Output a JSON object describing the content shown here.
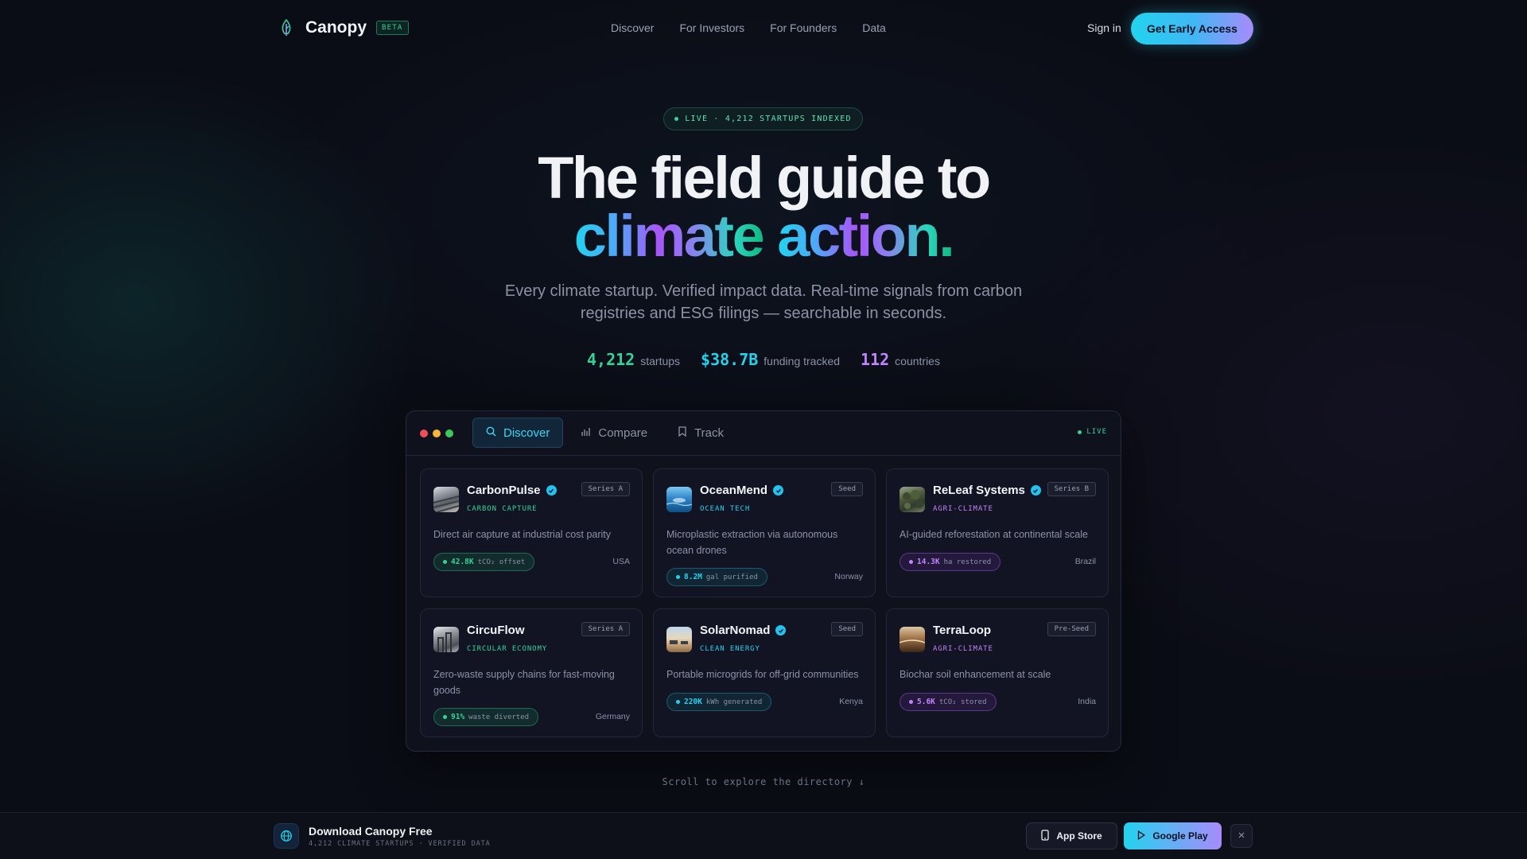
{
  "nav": {
    "brand": "Canopy",
    "badge": "BETA",
    "links": [
      "Discover",
      "For Investors",
      "For Founders",
      "Data"
    ],
    "signin": "Sign in",
    "cta": "Get Early Access"
  },
  "hero": {
    "live_pill": "LIVE · 4,212 STARTUPS INDEXED",
    "title_line1": "The field guide to",
    "title_word1": "climate",
    "title_word2": "action.",
    "subtitle": "Every climate startup. Verified impact data. Real-time signals from carbon registries and ESG filings — searchable in seconds.",
    "stats": [
      {
        "value": "4,212",
        "label": "startups",
        "color": "#34d399"
      },
      {
        "value": "$38.7B",
        "label": "funding tracked",
        "color": "#22d3ee"
      },
      {
        "value": "112",
        "label": "countries",
        "color": "#c084fc"
      }
    ]
  },
  "app": {
    "tabs": [
      {
        "label": "Discover",
        "icon": "search-icon"
      },
      {
        "label": "Compare",
        "icon": "bar-chart-icon"
      },
      {
        "label": "Track",
        "icon": "bookmark-icon"
      }
    ],
    "live_label": "LIVE",
    "cards": [
      {
        "name": "CarbonPulse",
        "verified": true,
        "category": "CARBON CAPTURE",
        "category_color": "#34d399",
        "stage": "Series A",
        "description": "Direct air capture at industrial cost parity",
        "metric_value": "42.8K",
        "metric_unit": "tCO₂ offset",
        "metric_tone": "green",
        "country": "USA",
        "logo": "industrial"
      },
      {
        "name": "OceanMend",
        "verified": true,
        "category": "OCEAN TECH",
        "category_color": "#22d3ee",
        "stage": "Seed",
        "description": "Microplastic extraction via autonomous ocean drones",
        "metric_value": "8.2M",
        "metric_unit": "gal purified",
        "metric_tone": "cyan",
        "country": "Norway",
        "logo": "ocean"
      },
      {
        "name": "ReLeaf Systems",
        "verified": true,
        "category": "AGRI-CLIMATE",
        "category_color": "#c084fc",
        "stage": "Series B",
        "description": "AI-guided reforestation at continental scale",
        "metric_value": "14.3K",
        "metric_unit": "ha restored",
        "metric_tone": "purple",
        "country": "Brazil",
        "logo": "forest"
      },
      {
        "name": "CircuFlow",
        "verified": false,
        "category": "CIRCULAR ECONOMY",
        "category_color": "#34d399",
        "stage": "Series A",
        "description": "Zero-waste supply chains for fast-moving goods",
        "metric_value": "91%",
        "metric_unit": "waste diverted",
        "metric_tone": "green",
        "country": "Germany",
        "logo": "factory"
      },
      {
        "name": "SolarNomad",
        "verified": true,
        "category": "CLEAN ENERGY",
        "category_color": "#22d3ee",
        "stage": "Seed",
        "description": "Portable microgrids for off-grid communities",
        "metric_value": "220K",
        "metric_unit": "kWh generated",
        "metric_tone": "cyan",
        "country": "Kenya",
        "logo": "desert"
      },
      {
        "name": "TerraLoop",
        "verified": false,
        "category": "AGRI-CLIMATE",
        "category_color": "#c084fc",
        "stage": "Pre-Seed",
        "description": "Biochar soil enhancement at scale",
        "metric_value": "5.6K",
        "metric_unit": "tCO₂ stored",
        "metric_tone": "purple",
        "country": "India",
        "logo": "soil"
      }
    ]
  },
  "scroll_hint": "Scroll to explore the directory ↓",
  "download": {
    "title": "Download Canopy Free",
    "subtitle": "4,212 CLIMATE STARTUPS · VERIFIED DATA",
    "appstore": "App Store",
    "googleplay": "Google Play"
  }
}
